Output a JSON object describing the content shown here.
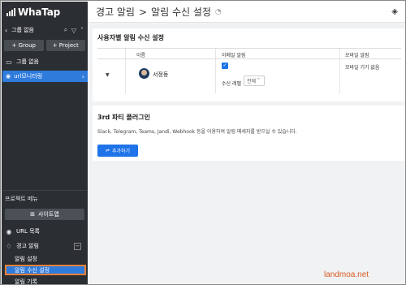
{
  "app": {
    "logo_text": "WhaTap"
  },
  "sidebar": {
    "group_label": "그룹 없음",
    "add_group_label": "+ Group",
    "add_project_label": "+ Project",
    "folder_label": "그룹 없음",
    "active_project": "url모니터링",
    "section_title": "프로젝트 메뉴",
    "sitemap_label": "사이트맵",
    "url_list_label": "URL 목록",
    "alert_label": "경고 알림",
    "alert_collapse": "−",
    "alert_settings_label": "알림 설정",
    "alert_receive_label": "알림 수신 설정",
    "alert_history_label": "알림 기록"
  },
  "header": {
    "breadcrumb_parent": "경고 알림",
    "breadcrumb_sep": ">",
    "breadcrumb_current": "알림 수신 설정",
    "clock_icon": "🕓",
    "paint_icon": "paint-bucket-icon"
  },
  "user_section": {
    "title": "사용자별 알림 수신 설정",
    "columns": [
      "이름",
      "이메일 알림",
      "모바일 알림"
    ],
    "row": {
      "expand": "▼",
      "name": "서정동",
      "email_checked": true,
      "level_label": "수신 레벨",
      "level_value": "전체",
      "mobile_text": "모바일 기기 없음"
    }
  },
  "plugin_section": {
    "title": "3rd 파티 플러그인",
    "description": "Slack, Telegram, Teams, Jandi, Webhook 등을 이용하여 알림 메세지를 받으실 수 있습니다.",
    "add_label": "추가하기"
  },
  "watermark": "landmoa.net"
}
